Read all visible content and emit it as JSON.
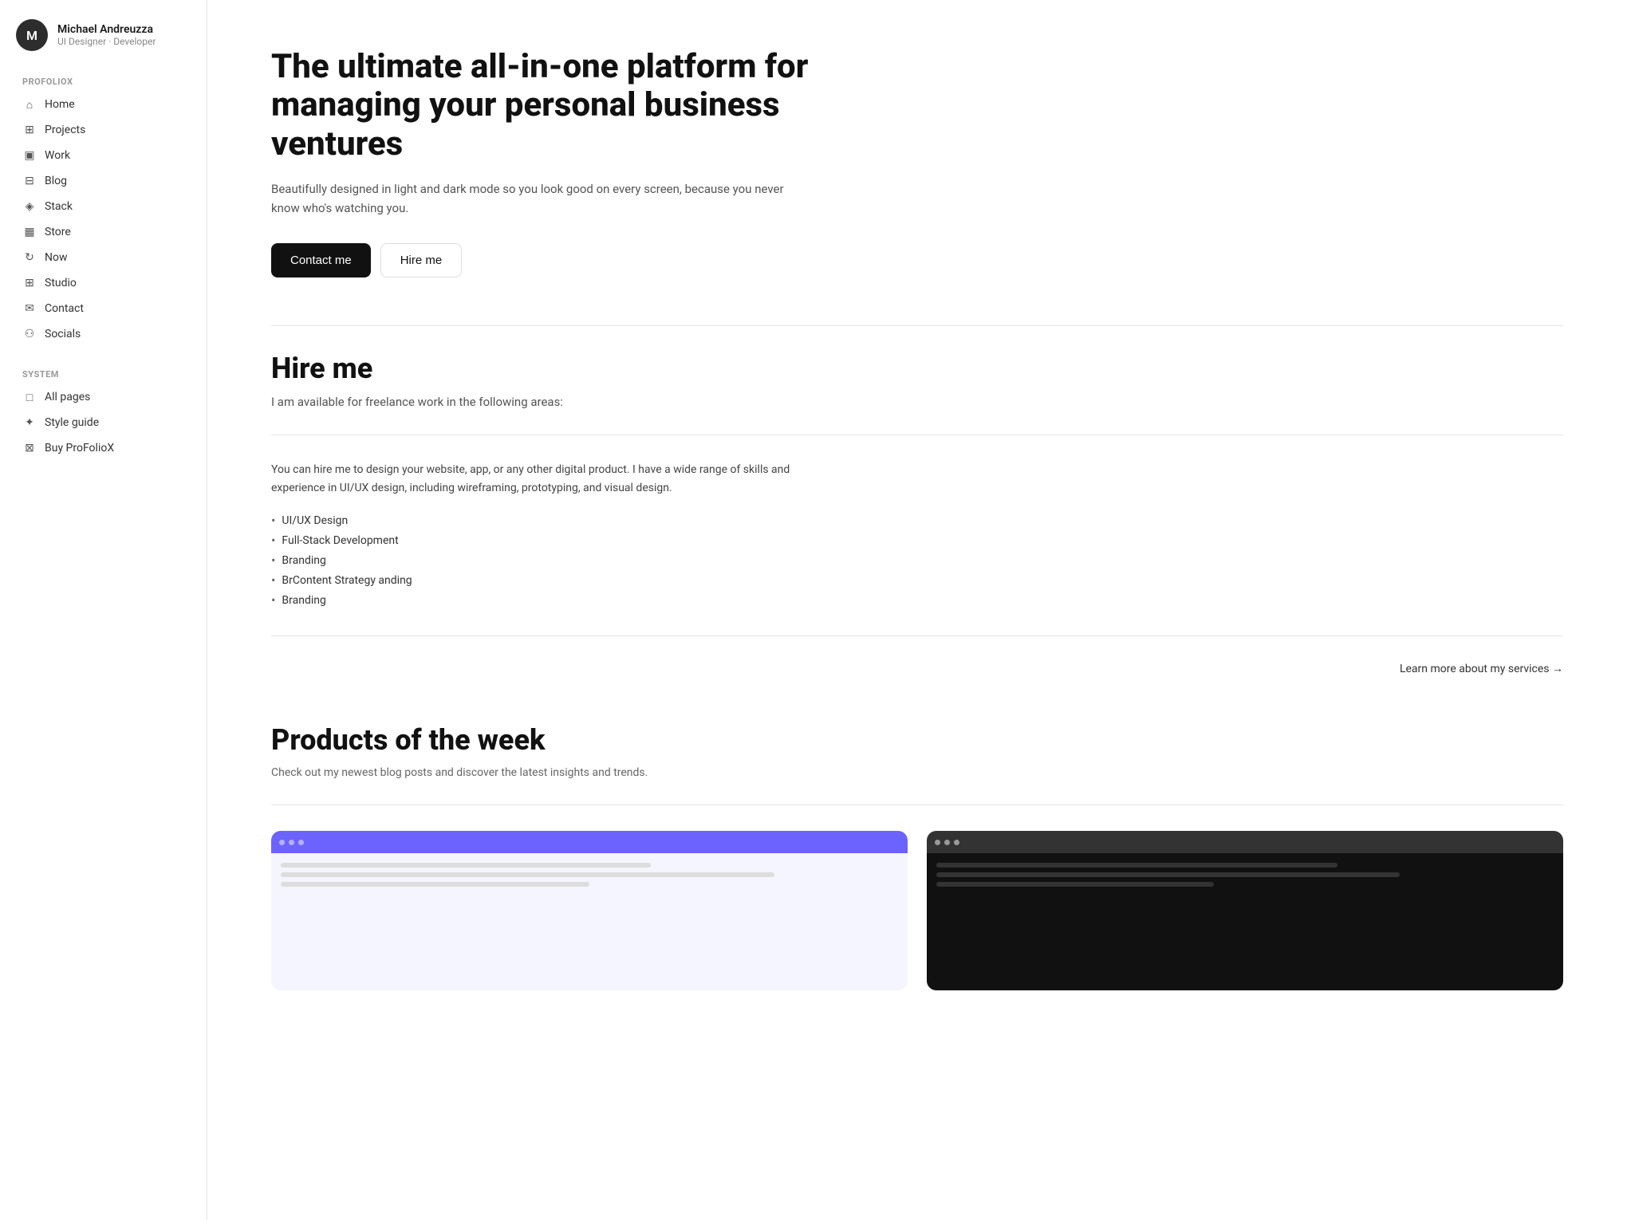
{
  "sidebar": {
    "brand": "PROFOLIOX",
    "profile": {
      "name": "Michael Andreuzza",
      "role": "UI Designer · Developer",
      "avatar_initial": "M"
    },
    "nav_items": [
      {
        "id": "home",
        "label": "Home",
        "icon": "home"
      },
      {
        "id": "projects",
        "label": "Projects",
        "icon": "projects"
      },
      {
        "id": "work",
        "label": "Work",
        "icon": "work"
      },
      {
        "id": "blog",
        "label": "Blog",
        "icon": "blog"
      },
      {
        "id": "stack",
        "label": "Stack",
        "icon": "stack"
      },
      {
        "id": "store",
        "label": "Store",
        "icon": "store"
      },
      {
        "id": "now",
        "label": "Now",
        "icon": "now"
      },
      {
        "id": "studio",
        "label": "Studio",
        "icon": "studio"
      },
      {
        "id": "contact",
        "label": "Contact",
        "icon": "contact"
      },
      {
        "id": "socials",
        "label": "Socials",
        "icon": "socials"
      }
    ],
    "system_label": "SYSTEM",
    "system_items": [
      {
        "id": "all-pages",
        "label": "All pages",
        "icon": "pages"
      },
      {
        "id": "style-guide",
        "label": "Style guide",
        "icon": "style"
      },
      {
        "id": "buy-profoliox",
        "label": "Buy ProFolioX",
        "icon": "buy"
      }
    ]
  },
  "hero": {
    "title": "The ultimate all-in-one platform for managing your personal business ventures",
    "subtitle": "Beautifully designed in light and dark mode so you look good on every screen, because you never know who's watching you.",
    "cta_primary": "Contact me",
    "cta_secondary": "Hire me"
  },
  "hire": {
    "title": "Hire me",
    "subtitle": "I am available for freelance work in the following areas:",
    "description": "You can hire me to design your website, app, or any other digital product. I have a wide range of skills and experience in UI/UX design, including wireframing, prototyping, and visual design.",
    "services": [
      "UI/UX Design",
      "Full-Stack Development",
      "Branding",
      "BrContent Strategy anding",
      "Branding"
    ],
    "learn_more": "Learn more about my services →"
  },
  "products": {
    "title": "Products of the week",
    "subtitle": "Check out my newest blog posts and discover the latest insights and trends.",
    "cards": [
      {
        "id": "card-light",
        "theme": "light"
      },
      {
        "id": "card-dark",
        "theme": "dark"
      }
    ]
  }
}
